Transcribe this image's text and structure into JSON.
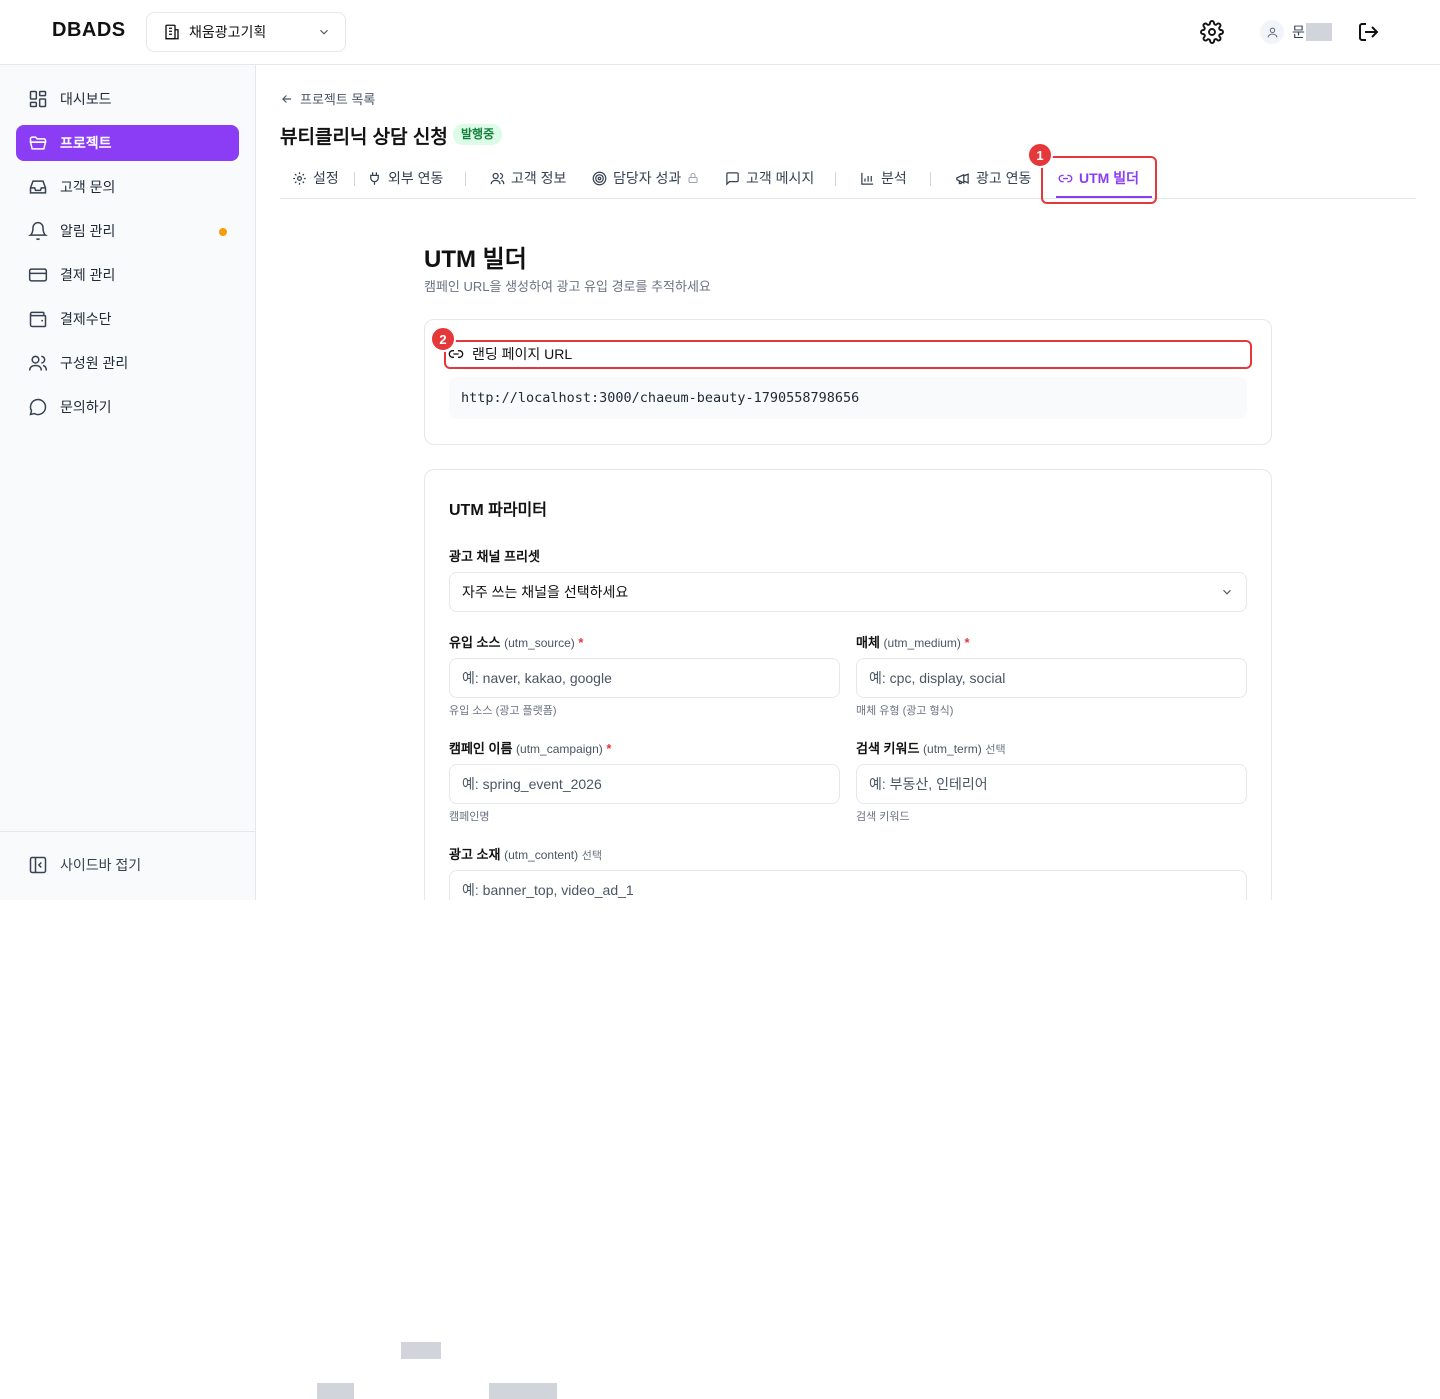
{
  "header": {
    "logo": "DBADS",
    "org_name": "채움광고기획",
    "user_name": "문"
  },
  "sidebar": {
    "items": [
      {
        "label": "대시보드",
        "icon": "dashboard-icon"
      },
      {
        "label": "프로젝트",
        "icon": "folder-icon",
        "active": true
      },
      {
        "label": "고객 문의",
        "icon": "inbox-icon"
      },
      {
        "label": "알림 관리",
        "icon": "bell-icon",
        "dot": true
      },
      {
        "label": "결제 관리",
        "icon": "credit-card-icon"
      },
      {
        "label": "결제수단",
        "icon": "wallet-icon"
      },
      {
        "label": "구성원 관리",
        "icon": "users-icon"
      },
      {
        "label": "문의하기",
        "icon": "chat-icon"
      }
    ],
    "collapse_label": "사이드바 접기"
  },
  "main": {
    "back_label": "프로젝트 목록",
    "project_title": "뷰티클리닉 상담 신청",
    "status_badge": "발행중",
    "tabs": [
      {
        "label": "설정"
      },
      {
        "label": "외부 연동"
      },
      {
        "label": "고객 정보"
      },
      {
        "label": "담당자 성과"
      },
      {
        "label": "고객 메시지"
      },
      {
        "label": "분석"
      },
      {
        "label": "광고 연동"
      },
      {
        "label": "UTM 빌더",
        "active": true
      }
    ],
    "step_badges": [
      "1",
      "2"
    ],
    "page_title": "UTM 빌더",
    "page_subtitle": "캠페인 URL을 생성하여 광고 유입 경로를 추적하세요",
    "landing": {
      "label": "랜딩 페이지 URL",
      "url": "http://localhost:3000/chaeum-beauty-1790558798656"
    },
    "params": {
      "title": "UTM 파라미터",
      "preset_label": "광고 채널 프리셋",
      "preset_value": "자주 쓰는 채널을 선택하세요",
      "source": {
        "label": "유입 소스",
        "key": "(utm_source)",
        "req": "*",
        "placeholder": "예: naver, kakao, google",
        "hint": "유입 소스 (광고 플랫폼)"
      },
      "medium": {
        "label": "매체",
        "key": "(utm_medium)",
        "req": "*",
        "placeholder": "예: cpc, display, social",
        "hint": "매체 유형 (광고 형식)"
      },
      "campaign": {
        "label": "캠페인 이름",
        "key": "(utm_campaign)",
        "req": "*",
        "placeholder": "예: spring_event_2026",
        "hint": "캠페인명"
      },
      "term": {
        "label": "검색 키워드",
        "key": "(utm_term)",
        "opt": "선택",
        "placeholder": "예: 부동산, 인테리어",
        "hint": "검색 키워드"
      },
      "content": {
        "label": "광고 소재",
        "key": "(utm_content)",
        "opt": "선택",
        "placeholder": "예: banner_top, video_ad_1"
      }
    }
  },
  "colors": {
    "accent": "#8b3cf5",
    "annotation": "#e5383b",
    "badge_bg": "#dcfce7",
    "badge_text": "#15803d"
  }
}
